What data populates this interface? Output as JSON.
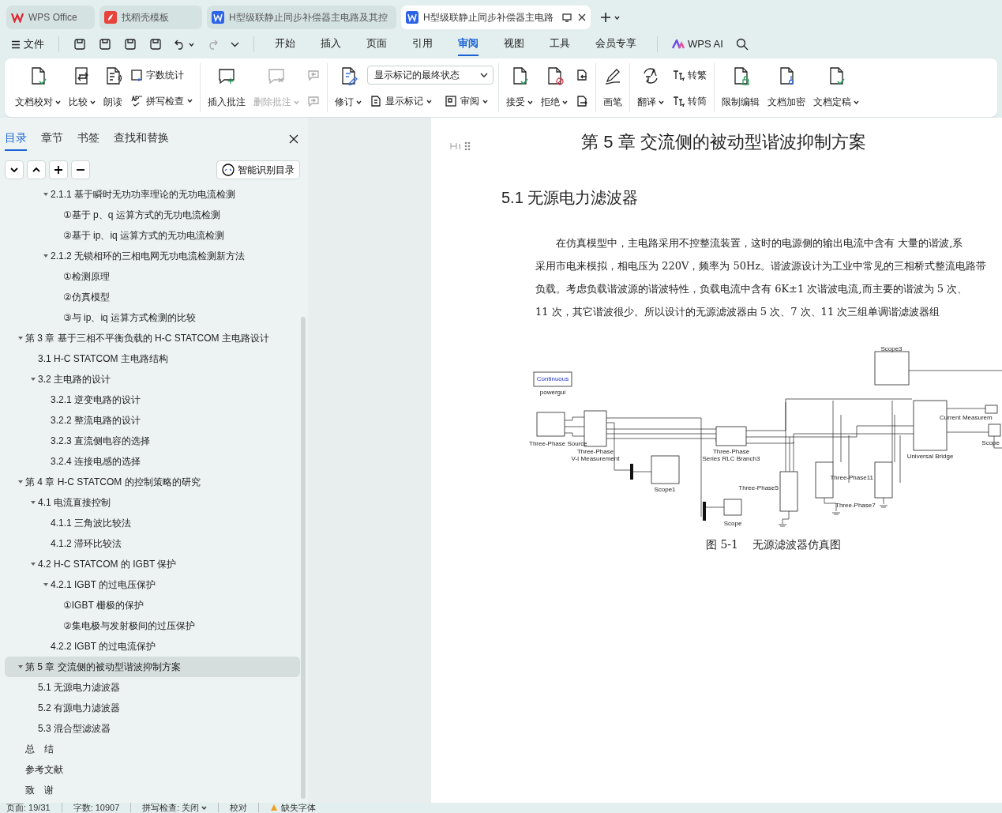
{
  "tabs": [
    {
      "kind": "home",
      "label": "WPS Office",
      "selected": false
    },
    {
      "kind": "template",
      "label": "找稻壳模板",
      "selected": false
    },
    {
      "kind": "doc",
      "label": "H型级联静止同步补偿器主电路及其控",
      "selected": false
    },
    {
      "kind": "doc",
      "label": "H型级联静止同步补偿器主电路",
      "selected": true
    }
  ],
  "menu": {
    "file": "文件",
    "tabs": [
      {
        "label": "开始",
        "selected": false
      },
      {
        "label": "插入",
        "selected": false
      },
      {
        "label": "页面",
        "selected": false
      },
      {
        "label": "引用",
        "selected": false
      },
      {
        "label": "审阅",
        "selected": true
      },
      {
        "label": "视图",
        "selected": false
      },
      {
        "label": "工具",
        "selected": false
      },
      {
        "label": "会员专享",
        "selected": false
      }
    ],
    "ai": "WPS AI"
  },
  "ribbon": {
    "groups": [
      {
        "items": [
          {
            "kind": "large",
            "label": "文档校对",
            "dropdown": true,
            "disabled": false
          },
          {
            "kind": "large",
            "label": "比较",
            "dropdown": true,
            "disabled": false
          },
          {
            "kind": "large",
            "label": "朗读",
            "dropdown": false,
            "disabled": false
          },
          {
            "kind": "stack",
            "entries": [
              {
                "kind": "button",
                "label": "字数统计",
                "dropdown": false,
                "disabled": false
              },
              {
                "kind": "button",
                "label": "拼写检查",
                "dropdown": true,
                "disabled": false
              }
            ]
          }
        ]
      },
      {
        "items": [
          {
            "kind": "large",
            "label": "插入批注",
            "dropdown": false,
            "disabled": false
          },
          {
            "kind": "large",
            "label": "删除批注",
            "dropdown": true,
            "disabled": true
          },
          {
            "kind": "stack",
            "entries": [
              {
                "kind": "button",
                "dropdown": false,
                "disabled": true
              },
              {
                "kind": "button",
                "dropdown": false,
                "disabled": true
              }
            ]
          }
        ]
      },
      {
        "items": [
          {
            "kind": "large",
            "label": "修订",
            "dropdown": true,
            "disabled": false
          },
          {
            "kind": "stack",
            "entries": [
              {
                "kind": "select",
                "value": "显示标记的最终状态"
              },
              {
                "kind": "pair",
                "entries": [
                  {
                    "label": "显示标记",
                    "dropdown": true,
                    "disabled": false
                  },
                  {
                    "label": "审阅",
                    "dropdown": true,
                    "disabled": false
                  }
                ]
              }
            ]
          }
        ]
      },
      {
        "items": [
          {
            "kind": "large",
            "label": "接受",
            "dropdown": true,
            "disabled": false
          },
          {
            "kind": "large",
            "label": "拒绝",
            "dropdown": true,
            "disabled": false
          },
          {
            "kind": "stack",
            "entries": [
              {
                "kind": "button",
                "dropdown": false,
                "disabled": false
              },
              {
                "kind": "button",
                "dropdown": false,
                "disabled": false
              }
            ]
          }
        ]
      },
      {
        "items": [
          {
            "kind": "large",
            "label": "画笔",
            "dropdown": false,
            "disabled": false
          }
        ]
      },
      {
        "items": [
          {
            "kind": "large",
            "label": "翻译",
            "dropdown": true,
            "disabled": false
          },
          {
            "kind": "stack",
            "entries": [
              {
                "kind": "button",
                "label": "转繁",
                "dropdown": false,
                "disabled": false
              },
              {
                "kind": "button",
                "label": "转简",
                "dropdown": false,
                "disabled": false
              }
            ]
          }
        ]
      },
      {
        "items": [
          {
            "kind": "large",
            "label": "限制编辑",
            "dropdown": false,
            "disabled": false
          },
          {
            "kind": "large",
            "label": "文档加密",
            "dropdown": false,
            "disabled": false
          },
          {
            "kind": "large",
            "label": "文档定稿",
            "dropdown": true,
            "disabled": false
          }
        ]
      }
    ]
  },
  "sidebar": {
    "tabs": [
      {
        "label": "目录",
        "selected": true
      },
      {
        "label": "章节",
        "selected": false
      },
      {
        "label": "书签",
        "selected": false
      },
      {
        "label": "查找和替换",
        "selected": false
      }
    ],
    "smart_button": "智能识别目录"
  },
  "toc": {
    "continued": [
      {
        "text": "2.1.1 基于瞬时无功功率理论的无功电流检测",
        "selected": false,
        "expanded": true,
        "children": [
          {
            "text": "①基于 p、q 运算方式的无功电流检测",
            "selected": false
          },
          {
            "text": "②基于 ip、iq 运算方式的无功电流检测",
            "selected": false
          }
        ]
      },
      {
        "text": "2.1.2 无锁相环的三相电网无功电流检测新方法",
        "selected": false,
        "expanded": true,
        "children": [
          {
            "text": "①检测原理",
            "selected": false
          },
          {
            "text": "②仿真模型",
            "selected": false
          },
          {
            "text": "③与 ip、iq 运算方式检测的比较",
            "selected": false
          }
        ]
      }
    ],
    "items": [
      {
        "text": "第 3 章  基于三相不平衡负载的 H-C STATCOM 主电路设计",
        "selected": false,
        "expanded": true,
        "children": [
          {
            "text": "3.1 H-C  STATCOM 主电路结构",
            "selected": false
          },
          {
            "text": "3.2 主电路的设计",
            "selected": false,
            "expanded": true,
            "children": [
              {
                "text": "3.2.1 逆变电路的设计",
                "selected": false
              },
              {
                "text": "3.2.2 整流电路的设计",
                "selected": false
              },
              {
                "text": "3.2.3 直流侧电容的选择",
                "selected": false
              },
              {
                "text": "3.2.4 连接电感的选择",
                "selected": false
              }
            ]
          }
        ]
      },
      {
        "text": "第 4 章  H-C STATCOM 的控制策略的研究",
        "selected": false,
        "expanded": true,
        "children": [
          {
            "text": "4.1 电流直接控制",
            "selected": false,
            "expanded": true,
            "children": [
              {
                "text": "4.1.1 三角波比较法",
                "selected": false
              },
              {
                "text": "4.1.2 滞环比较法",
                "selected": false
              }
            ]
          },
          {
            "text": "4.2 H-C  STATCOM 的 IGBT 保护",
            "selected": false,
            "expanded": true,
            "children": [
              {
                "text": "4.2.1 IGBT 的过电压保护",
                "selected": false,
                "expanded": true,
                "children": [
                  {
                    "text": "①IGBT 栅极的保护",
                    "selected": false
                  },
                  {
                    "text": "②集电极与发射极间的过压保护",
                    "selected": false
                  }
                ]
              },
              {
                "text": "4.2.2 IGBT 的过电流保护",
                "selected": false
              }
            ]
          }
        ]
      },
      {
        "text": "第 5 章  交流侧的被动型谐波抑制方案",
        "selected": true,
        "expanded": true,
        "children": [
          {
            "text": "5.1  无源电力滤波器",
            "selected": false
          },
          {
            "text": "5.2 有源电力滤波器",
            "selected": false
          },
          {
            "text": "5.3 混合型滤波器",
            "selected": false
          }
        ]
      },
      {
        "text": "总　结",
        "selected": false
      },
      {
        "text": "参考文献",
        "selected": false
      },
      {
        "text": "致　谢",
        "selected": false
      }
    ]
  },
  "document": {
    "chapter_title": "第 5 章  交流侧的被动型谐波抑制方案",
    "section_title": "5.1  无源电力滤波器",
    "paragraph_lines": [
      "在仿真模型中，主电路采用不控整流装置，这时的电源侧的输出电流中含有 大量的谐波,系",
      "采用市电来模拟，相电压为 220V，频率为 50Hz。谐波源设计为工业中常见的三相桥式整流电路带",
      "负载。考虑负载谐波源的谐波特性，负载电流中含有 6K±1  次谐波电流,而主要的谐波为  5  次、",
      "11  次，其它谐波很少。所以设计的无源滤波器由  5  次、7  次、11  次三组单调谐滤波器组"
    ],
    "figure_labels": [
      "Continuous",
      "powergui",
      "Three-Phase Source",
      "Three-Phase",
      "V-I Measurement",
      "Three-Phase",
      "Series RLC Branch3",
      "Scope1",
      "Scope",
      "Scope3",
      "Three-Phase5",
      "Three-Phase7",
      "Three-Phase11",
      "Universal Bridge",
      "Current Measurem",
      "Scope"
    ],
    "caption": "图 5-1　 无源滤波器仿真图"
  },
  "status_bar": [
    {
      "kind": "text",
      "label": "页面: 19/31"
    },
    {
      "kind": "text",
      "label": "字数: 10907"
    },
    {
      "kind": "dropdown",
      "label": "拼写检查: 关闭"
    },
    {
      "kind": "text",
      "label": "校对"
    },
    {
      "kind": "warning",
      "label": "缺失字体"
    }
  ]
}
